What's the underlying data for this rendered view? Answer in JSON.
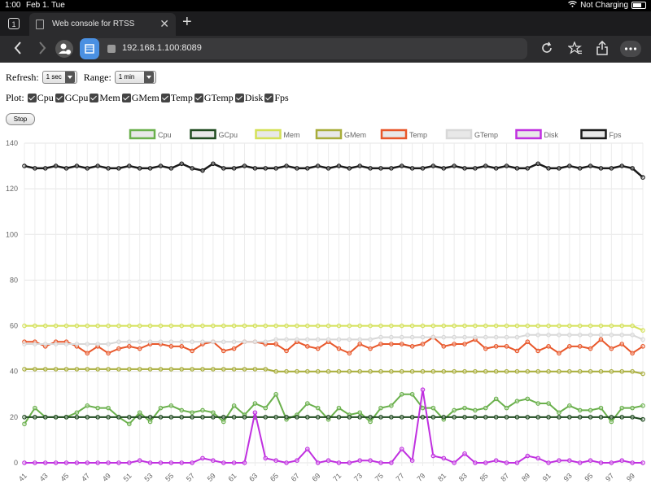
{
  "status_bar": {
    "time": "1:00",
    "date": "Feb 1. Tue",
    "charging": "Not Charging"
  },
  "browser": {
    "tab_count": "1",
    "tab_title": "Web console for RTSS",
    "url": "192.168.1.100:8089",
    "icons": [
      "back-icon",
      "forward-icon",
      "profile-icon",
      "tab-icon",
      "reload-icon",
      "bookmark-icon",
      "share-icon",
      "more-icon",
      "new-tab-icon",
      "close-icon"
    ]
  },
  "controls": {
    "refresh_label": "Refresh:",
    "refresh_value": "1 sec",
    "range_label": "Range:",
    "range_value": "1 min",
    "plot_label": "Plot:",
    "plot_options": [
      "Cpu",
      "GCpu",
      "Mem",
      "GMem",
      "Temp",
      "GTemp",
      "Disk",
      "Fps"
    ],
    "stop_label": "Stop"
  },
  "chart_data": {
    "type": "line",
    "x": [
      41,
      42,
      43,
      44,
      45,
      46,
      47,
      48,
      49,
      50,
      51,
      52,
      53,
      54,
      55,
      56,
      57,
      58,
      59,
      60,
      61,
      62,
      63,
      64,
      65,
      66,
      67,
      68,
      69,
      70,
      71,
      72,
      73,
      74,
      75,
      76,
      77,
      78,
      79,
      80,
      81,
      82,
      83,
      84,
      85,
      86,
      87,
      88,
      89,
      90,
      91,
      92,
      93,
      94,
      95,
      96,
      97,
      98,
      99,
      100
    ],
    "x_ticks": [
      41,
      43,
      45,
      47,
      49,
      51,
      53,
      55,
      57,
      59,
      61,
      63,
      65,
      67,
      69,
      71,
      73,
      75,
      77,
      79,
      81,
      83,
      85,
      87,
      89,
      91,
      93,
      95,
      97,
      99
    ],
    "ylim": [
      0,
      140
    ],
    "y_ticks": [
      0,
      20,
      40,
      60,
      80,
      100,
      120,
      140
    ],
    "grid": true,
    "legend_position": "top",
    "series": [
      {
        "name": "Cpu",
        "color": "#6ab04c",
        "width": 2,
        "values": [
          17,
          24,
          20,
          20,
          20,
          22,
          25,
          24,
          24,
          20,
          17,
          22,
          18,
          24,
          25,
          23,
          22,
          23,
          22,
          18,
          25,
          21,
          26,
          24,
          30,
          19,
          21,
          26,
          24,
          19,
          24,
          21,
          22,
          18,
          24,
          25,
          30,
          30,
          24,
          24,
          19,
          23,
          24,
          23,
          24,
          28,
          24,
          27,
          28,
          26,
          26,
          22,
          25,
          23,
          23,
          24,
          18,
          24,
          24,
          25
        ]
      },
      {
        "name": "GCpu",
        "color": "#1f4a1f",
        "width": 2,
        "values": [
          20,
          20,
          20,
          20,
          20,
          20,
          20,
          20,
          20,
          20,
          20,
          20,
          20,
          20,
          20,
          20,
          20,
          20,
          20,
          20,
          20,
          20,
          20,
          20,
          20,
          20,
          20,
          20,
          20,
          20,
          20,
          20,
          20,
          20,
          20,
          20,
          20,
          20,
          20,
          20,
          20,
          20,
          20,
          20,
          20,
          20,
          20,
          20,
          20,
          20,
          20,
          20,
          20,
          20,
          20,
          20,
          20,
          20,
          20,
          19
        ]
      },
      {
        "name": "Mem",
        "color": "#d4e157",
        "width": 2,
        "values": [
          60,
          60,
          60,
          60,
          60,
          60,
          60,
          60,
          60,
          60,
          60,
          60,
          60,
          60,
          60,
          60,
          60,
          60,
          60,
          60,
          60,
          60,
          60,
          60,
          60,
          60,
          60,
          60,
          60,
          60,
          60,
          60,
          60,
          60,
          60,
          60,
          60,
          60,
          60,
          60,
          60,
          60,
          60,
          60,
          60,
          60,
          60,
          60,
          60,
          60,
          60,
          60,
          60,
          60,
          60,
          60,
          60,
          60,
          60,
          58
        ]
      },
      {
        "name": "GMem",
        "color": "#a8ad3a",
        "width": 2,
        "values": [
          41,
          41,
          41,
          41,
          41,
          41,
          41,
          41,
          41,
          41,
          41,
          41,
          41,
          41,
          41,
          41,
          41,
          41,
          41,
          41,
          41,
          41,
          41,
          41,
          40,
          40,
          40,
          40,
          40,
          40,
          40,
          40,
          40,
          40,
          40,
          40,
          40,
          40,
          40,
          40,
          40,
          40,
          40,
          40,
          40,
          40,
          40,
          40,
          40,
          40,
          40,
          40,
          40,
          40,
          40,
          40,
          40,
          40,
          40,
          39
        ]
      },
      {
        "name": "Temp",
        "color": "#e8572a",
        "width": 2,
        "values": [
          53,
          53,
          51,
          53,
          53,
          51,
          48,
          51,
          48,
          50,
          51,
          50,
          52,
          52,
          51,
          51,
          49,
          52,
          53,
          49,
          50,
          53,
          53,
          52,
          52,
          49,
          53,
          51,
          50,
          53,
          50,
          48,
          52,
          50,
          52,
          52,
          52,
          51,
          52,
          55,
          51,
          52,
          52,
          54,
          50,
          51,
          51,
          49,
          53,
          49,
          51,
          48,
          51,
          51,
          50,
          54,
          50,
          52,
          48,
          51
        ]
      },
      {
        "name": "GTemp",
        "color": "#d8d8d8",
        "width": 2,
        "values": [
          52,
          52,
          52,
          52,
          52,
          52,
          52,
          52,
          52,
          53,
          53,
          53,
          53,
          53,
          53,
          53,
          53,
          53,
          53,
          53,
          53,
          53,
          53,
          53,
          54,
          54,
          54,
          54,
          54,
          54,
          54,
          54,
          54,
          54,
          55,
          55,
          55,
          55,
          55,
          55,
          55,
          55,
          55,
          55,
          55,
          55,
          55,
          55,
          56,
          56,
          56,
          56,
          56,
          56,
          56,
          56,
          56,
          56,
          56,
          54
        ]
      },
      {
        "name": "Disk",
        "color": "#c030e0",
        "width": 2,
        "values": [
          0,
          0,
          0,
          0,
          0,
          0,
          0,
          0,
          0,
          0,
          0,
          1,
          0,
          0,
          0,
          0,
          0,
          2,
          1,
          0,
          0,
          0,
          22,
          2,
          1,
          0,
          1,
          6,
          0,
          1,
          0,
          0,
          1,
          1,
          0,
          0,
          6,
          1,
          32,
          3,
          2,
          0,
          4,
          0,
          0,
          1,
          0,
          0,
          3,
          2,
          0,
          1,
          1,
          0,
          1,
          0,
          0,
          1,
          0,
          0
        ]
      },
      {
        "name": "Fps",
        "color": "#1a1a1a",
        "width": 2.5,
        "values": [
          130,
          129,
          129,
          130,
          129,
          130,
          129,
          130,
          129,
          129,
          130,
          129,
          129,
          130,
          129,
          131,
          129,
          128,
          131,
          129,
          129,
          130,
          129,
          129,
          129,
          130,
          129,
          129,
          130,
          129,
          130,
          129,
          130,
          129,
          129,
          129,
          130,
          129,
          129,
          130,
          129,
          130,
          129,
          129,
          130,
          129,
          130,
          129,
          129,
          131,
          129,
          129,
          130,
          129,
          130,
          129,
          129,
          130,
          129,
          125
        ]
      }
    ]
  }
}
